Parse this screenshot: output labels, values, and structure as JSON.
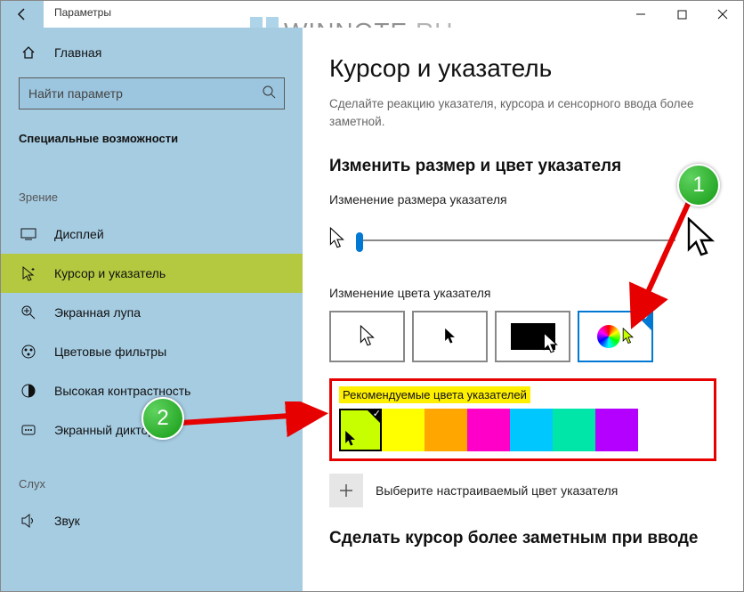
{
  "titlebar": {
    "title": "Параметры"
  },
  "watermark": {
    "text1": "WINNOTE",
    "text2": ".RU"
  },
  "sidebar": {
    "home": "Главная",
    "search_placeholder": "Найти параметр",
    "section": "Специальные возможности",
    "cat_vision": "Зрение",
    "items_vision": [
      "Дисплей",
      "Курсор и указатель",
      "Экранная лупа",
      "Цветовые фильтры",
      "Высокая контрастность",
      "Экранный диктор"
    ],
    "selected_vision_index": 1,
    "cat_hearing": "Слух",
    "items_hearing": [
      "Звук"
    ]
  },
  "main": {
    "h1": "Курсор и указатель",
    "desc": "Сделайте реакцию указателя, курсора и сенсорного ввода более заметной.",
    "h2a": "Изменить размер и цвет указателя",
    "label_size": "Изменение размера указателя",
    "label_color": "Изменение цвета указателя",
    "reco_label": "Рекомендуемые цвета указателей",
    "reco_colors": [
      "#c8ff00",
      "#ffff00",
      "#ffa600",
      "#ff00c8",
      "#00c8ff",
      "#00e6a8",
      "#b400ff"
    ],
    "reco_selected_index": 0,
    "add_label": "Выберите настраиваемый цвет указателя",
    "h2b": "Сделать курсор более заметным при вводе"
  },
  "annotations": {
    "badge1": "1",
    "badge2": "2"
  }
}
